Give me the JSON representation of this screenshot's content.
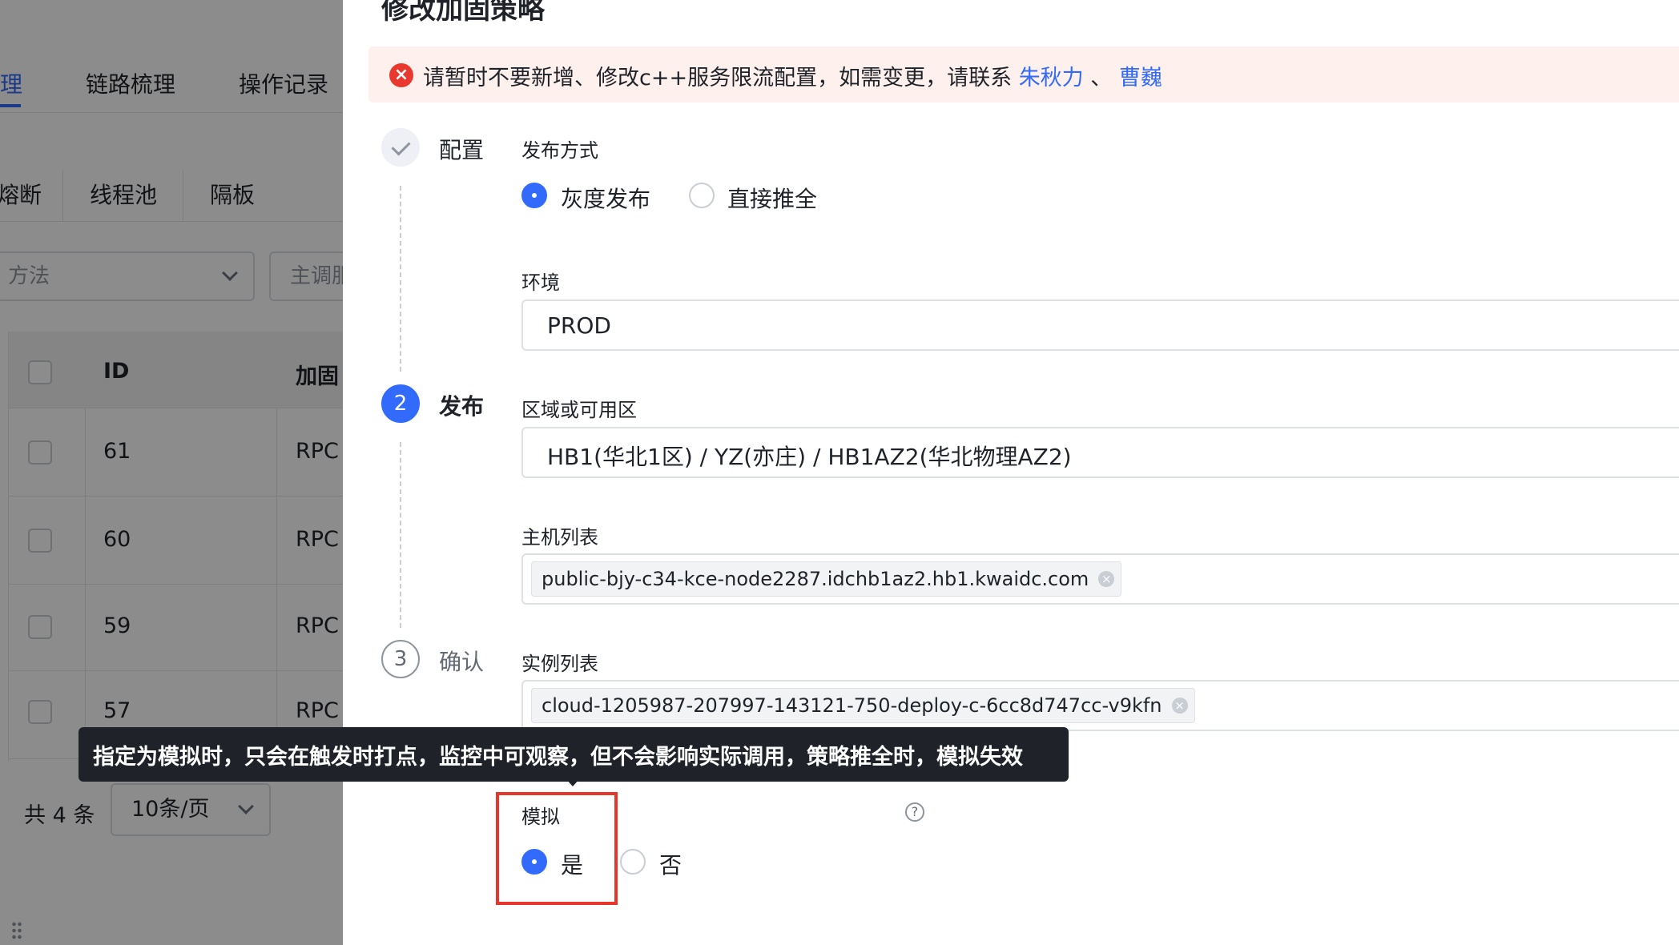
{
  "background_page": {
    "tabs": [
      {
        "label": "理",
        "active": true
      },
      {
        "label": "链路梳理",
        "active": false
      },
      {
        "label": "操作记录",
        "active": false
      }
    ],
    "subtabs": [
      "熔断",
      "线程池",
      "隔板"
    ],
    "filters": {
      "method_placeholder": "方法",
      "caller_placeholder": "主调服务"
    },
    "table": {
      "headers": [
        "ID",
        "加固"
      ],
      "rows": [
        {
          "id": "61",
          "type": "RPC"
        },
        {
          "id": "60",
          "type": "RPC"
        },
        {
          "id": "59",
          "type": "RPC"
        },
        {
          "id": "57",
          "type": "RPC"
        }
      ]
    },
    "total": "共 4 条",
    "page_size": "10条/页"
  },
  "drawer": {
    "title": "修改加固策略",
    "alert": {
      "text": "请暂时不要新增、修改c++服务限流配置，如需变更，请联系",
      "contact_1": "朱秋力",
      "separator": "、",
      "contact_2": "曹巍",
      "icon": "error-circle-icon",
      "color": "#e9392f"
    },
    "steps": [
      {
        "number": "",
        "label": "配置",
        "status": "done"
      },
      {
        "number": "2",
        "label": "发布",
        "status": "active"
      },
      {
        "number": "3",
        "label": "确认",
        "status": "pending"
      }
    ],
    "form": {
      "release_mode": {
        "label": "发布方式",
        "options": [
          {
            "label": "灰度发布",
            "selected": true
          },
          {
            "label": "直接推全",
            "selected": false
          }
        ]
      },
      "environment": {
        "label": "环境",
        "value": "PROD"
      },
      "zone": {
        "label": "区域或可用区",
        "value": "HB1(华北1区) / YZ(亦庄) / HB1AZ2(华北物理AZ2)"
      },
      "hosts": {
        "label": "主机列表",
        "tags": [
          "public-bjy-c34-kce-node2287.idchb1az2.hb1.kwaidc.com"
        ]
      },
      "instances": {
        "label": "实例列表",
        "tags": [
          "cloud-1205987-207997-143121-750-deploy-c-6cc8d747cc-v9kfn"
        ]
      },
      "simulate": {
        "label": "模拟",
        "help_icon": "?",
        "options": [
          {
            "label": "是",
            "selected": true
          },
          {
            "label": "否",
            "selected": false
          }
        ]
      }
    },
    "tooltip": "指定为模拟时，只会在触发时打点，监控中可观察，但不会影响实际调用，策略推全时，模拟失效",
    "accent_color": "#326BFB",
    "highlight_color": "#e6362c"
  }
}
